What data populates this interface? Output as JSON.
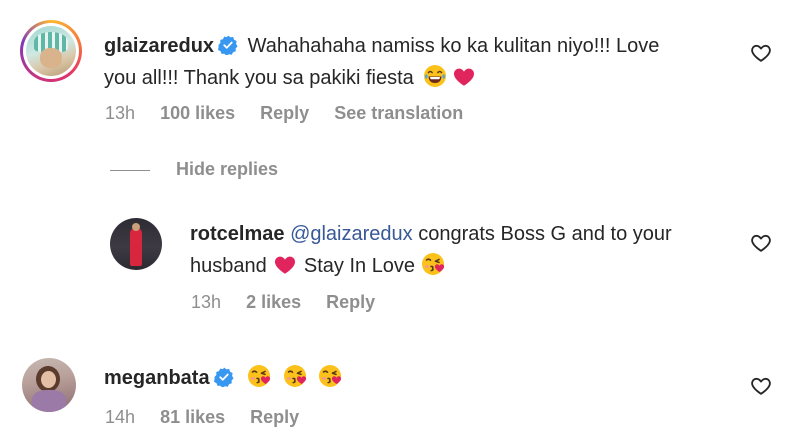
{
  "comments": [
    {
      "username": "glaizaredux",
      "verified": true,
      "text_line1": "Wahahahaha namiss ko ka kulitan niyo!!! Love",
      "text_line2": "you all!!! Thank you sa pakiki fiesta",
      "time": "13h",
      "likes": "100 likes",
      "reply": "Reply",
      "translate": "See translation",
      "hide_replies": "Hide replies"
    },
    {
      "username": "rotcelmae",
      "mention": "@glaizaredux",
      "text_line1_rest": "congrats Boss G and to your",
      "text_line2_a": "husband",
      "text_line2_b": "Stay In Love",
      "time": "13h",
      "likes": "2 likes",
      "reply": "Reply"
    },
    {
      "username": "meganbata",
      "verified": true,
      "time": "14h",
      "likes": "81 likes",
      "reply": "Reply"
    }
  ],
  "icons": {
    "like": "heart-outline-icon",
    "verified": "verified-badge-icon",
    "laugh": "laughing-tears-emoji",
    "love": "red-heart-emoji",
    "kiss": "face-blowing-kiss-emoji"
  },
  "colors": {
    "text": "#262626",
    "secondary": "#8e8e8e",
    "verified": "#3897f0",
    "heart": "#e0245e",
    "mention": "#385898"
  }
}
